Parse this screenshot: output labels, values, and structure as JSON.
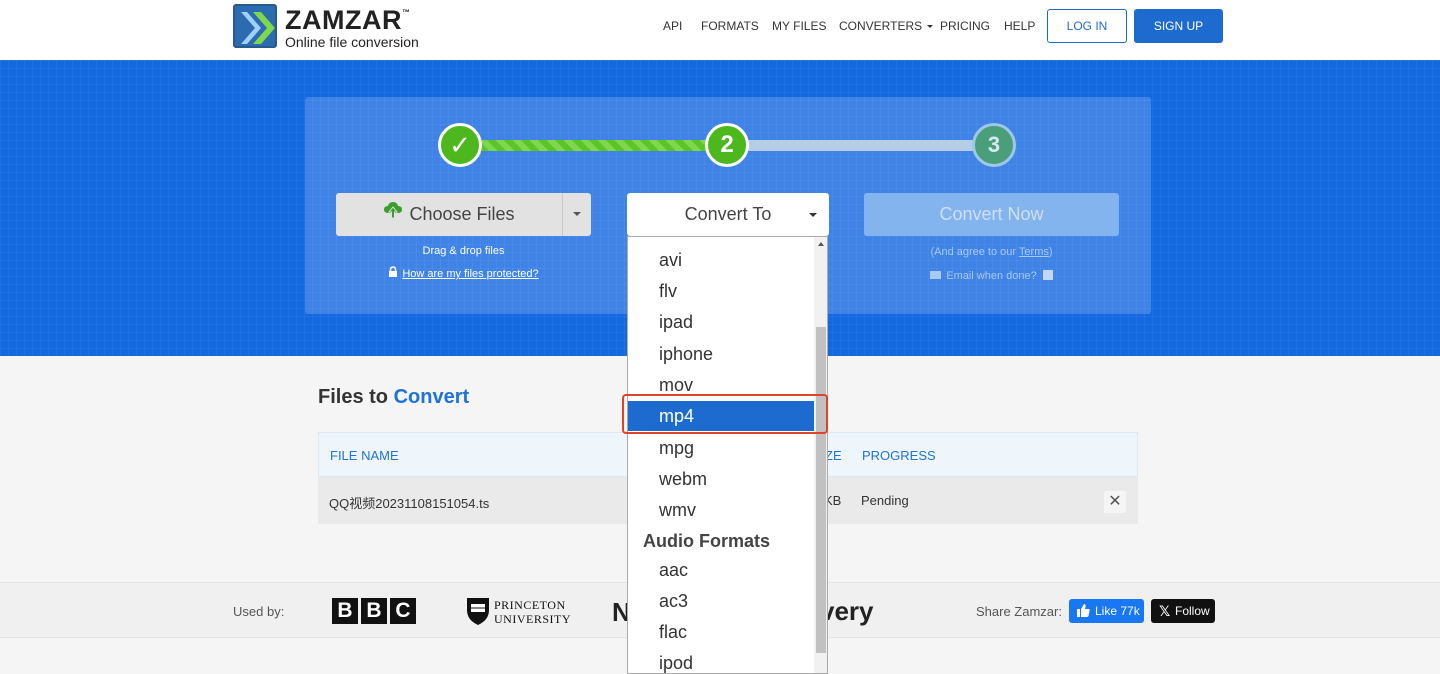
{
  "header": {
    "logo_name": "ZAMZAR",
    "logo_tm": "™",
    "logo_tagline": "Online file conversion",
    "nav": [
      {
        "label": "API"
      },
      {
        "label": "FORMATS"
      },
      {
        "label": "MY FILES"
      },
      {
        "label": "CONVERTERS"
      },
      {
        "label": "PRICING"
      },
      {
        "label": "HELP"
      }
    ],
    "login_label": "LOG IN",
    "signup_label": "SIGN UP"
  },
  "steps": {
    "step1": "✓",
    "step2": "2",
    "step3": "3"
  },
  "upload": {
    "choose_label": "Choose Files",
    "drag_text": "Drag & drop files",
    "protect_link": "How are my files protected?"
  },
  "convert": {
    "select_label": "Convert To",
    "now_label": "Convert Now",
    "agree_prefix": "(And agree to our ",
    "agree_link": "Terms",
    "agree_suffix": ")",
    "email_label": "Email when done?"
  },
  "dropdown": {
    "video_items": [
      "avi",
      "flv",
      "ipad",
      "iphone",
      "mov",
      "mp4",
      "mpg",
      "webm",
      "wmv"
    ],
    "selected": "mp4",
    "audio_group": "Audio Formats",
    "audio_items": [
      "aac",
      "ac3",
      "flac",
      "ipod"
    ]
  },
  "files": {
    "title_prefix": "Files to ",
    "title_accent": "Convert",
    "columns": {
      "name": "FILE NAME",
      "size_fragment": "ZE",
      "progress": "PROGRESS"
    },
    "rows": [
      {
        "name": "QQ视频20231108151054.ts",
        "size_fragment": "KB",
        "progress": "Pending"
      }
    ],
    "remove_symbol": "✕"
  },
  "usedby": {
    "label": "Used by:",
    "bbc": [
      "B",
      "B",
      "C"
    ],
    "princeton_line1": "PRINCETON",
    "princeton_line2": "UNIVERSITY",
    "nasa_fragment": "N",
    "discovery_fragment": "very",
    "share_label": "Share Zamzar:",
    "like_label": "Like 77k",
    "follow_label": "Follow"
  }
}
